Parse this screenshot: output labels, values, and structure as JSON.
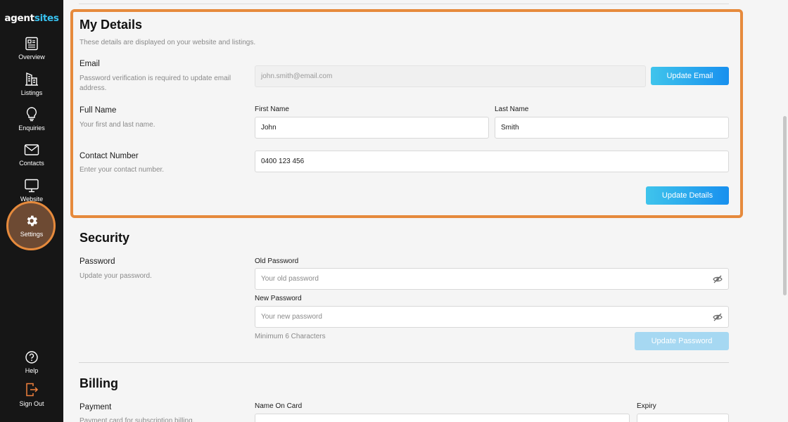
{
  "sidebar": {
    "logo_main": "agent",
    "logo_accent": "sites",
    "items": [
      {
        "label": "Overview",
        "icon": "overview-icon"
      },
      {
        "label": "Listings",
        "icon": "listings-icon"
      },
      {
        "label": "Enquiries",
        "icon": "lightbulb-icon"
      },
      {
        "label": "Contacts",
        "icon": "envelope-icon"
      },
      {
        "label": "Website",
        "icon": "monitor-icon"
      },
      {
        "label": "Settings",
        "icon": "gear-icon",
        "active": true
      }
    ],
    "bottom_items": [
      {
        "label": "Help",
        "icon": "help-icon"
      },
      {
        "label": "Sign Out",
        "icon": "sign-out-icon"
      }
    ]
  },
  "my_details": {
    "title": "My Details",
    "subtitle": "These details are displayed on your website and listings.",
    "email": {
      "label": "Email",
      "description": "Password verification is required to update email address.",
      "placeholder": "john.smith@email.com",
      "button": "Update Email"
    },
    "full_name": {
      "label": "Full Name",
      "description": "Your first and last name.",
      "first_label": "First Name",
      "first_value": "John",
      "last_label": "Last Name",
      "last_value": "Smith"
    },
    "contact": {
      "label": "Contact Number",
      "description": "Enter your contact number.",
      "value": "0400 123 456"
    },
    "update_button": "Update Details"
  },
  "security": {
    "title": "Security",
    "password_label": "Password",
    "password_description": "Update your password.",
    "old_label": "Old Password",
    "old_placeholder": "Your old password",
    "new_label": "New Password",
    "new_placeholder": "Your new password",
    "hint": "Minimum 6 Characters",
    "button": "Update Password"
  },
  "billing": {
    "title": "Billing",
    "payment_label": "Payment",
    "payment_description": "Payment card for subscription billing.",
    "name_on_card_label": "Name On Card",
    "expiry_label": "Expiry"
  },
  "colors": {
    "sidebar_bg": "#161616",
    "accent_blue": "#1890ee",
    "highlight_orange": "#e68a3c"
  }
}
